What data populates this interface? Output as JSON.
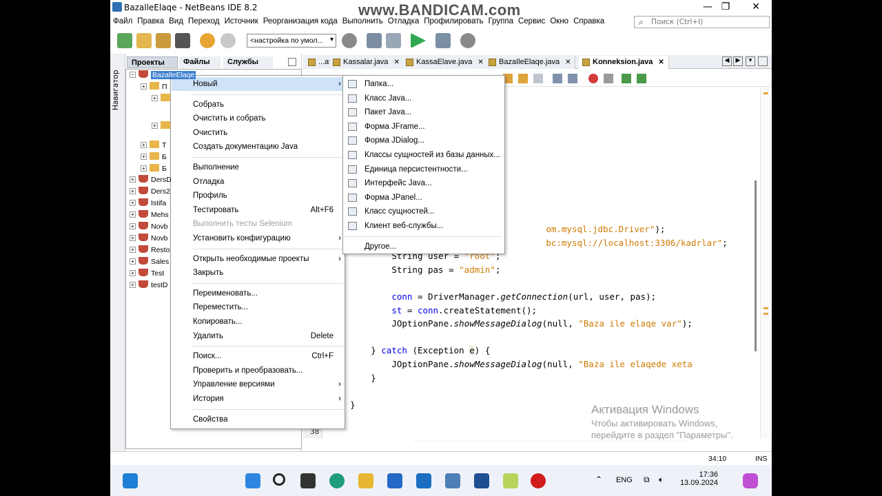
{
  "window": {
    "title": "BazalleElaqe - NetBeans IDE 8.2",
    "watermark": "www.BANDICAM.com"
  },
  "menubar": [
    "Файл",
    "Правка",
    "Вид",
    "Переход",
    "Источник",
    "Реорганизация кода",
    "Выполнить",
    "Отладка",
    "Профилировать",
    "Группа",
    "Сервис",
    "Окно",
    "Справка"
  ],
  "search": {
    "placeholder": "Поиск (Ctrl+I)"
  },
  "toolbar": {
    "config_value": "<настройка по умол..."
  },
  "left_panel": {
    "tabs": [
      "Проекты",
      "Файлы",
      "Службы"
    ],
    "navigator_label": "Навигатор",
    "tree": {
      "root": "BazalleElaqe",
      "sub": [
        {
          "label": "П",
          "kind": "folder"
        },
        {
          "label": "",
          "kind": "folder"
        },
        {
          "label": "",
          "kind": "folder"
        },
        {
          "label": "Т",
          "kind": "folder"
        },
        {
          "label": "Б",
          "kind": "folder"
        },
        {
          "label": "Б",
          "kind": "folder"
        }
      ],
      "projects": [
        "DersD",
        "Ders2",
        "Istifa",
        "Mehs",
        "Novb",
        "Novb",
        "Resto",
        "Sales",
        "Test",
        "testD"
      ]
    }
  },
  "editor": {
    "tabs": [
      {
        "label": "...ava",
        "active": false
      },
      {
        "label": "Kassalar.java",
        "active": false
      },
      {
        "label": "KassaElave.java",
        "active": false
      },
      {
        "label": "BazaIleElaqe.java",
        "active": false
      },
      {
        "label": "Konneksion.java",
        "active": true
      }
    ],
    "code_lines": [
      {
        "indent": "            ",
        "parts": [
          {
            "t": "om.mysql.jdbc.Driver\"",
            "c": "str"
          },
          {
            "t": ");",
            "c": ""
          }
        ],
        "offset": 224
      },
      {
        "indent": "            ",
        "parts": [
          {
            "t": "bc:mysql://localhost:3306/kadrlar\"",
            "c": "str"
          },
          {
            "t": ";",
            "c": ""
          }
        ],
        "offset": 224
      },
      {
        "indent": "            ",
        "parts": [
          {
            "t": "String user = ",
            "c": ""
          },
          {
            "t": "\"root\"",
            "c": "str"
          },
          {
            "t": ";",
            "c": ""
          }
        ],
        "offset": 0
      },
      {
        "indent": "            ",
        "parts": [
          {
            "t": "String pas = ",
            "c": ""
          },
          {
            "t": "\"admin\"",
            "c": "str"
          },
          {
            "t": ";",
            "c": ""
          }
        ],
        "offset": 0
      },
      {
        "indent": "",
        "parts": [],
        "offset": 0
      },
      {
        "indent": "            ",
        "parts": [
          {
            "t": "conn",
            "c": "kw"
          },
          {
            "t": " = DriverManager.",
            "c": ""
          },
          {
            "t": "getConnection",
            "c": "it"
          },
          {
            "t": "(url, user, pas);",
            "c": ""
          }
        ],
        "offset": 0
      },
      {
        "indent": "            ",
        "parts": [
          {
            "t": "st",
            "c": "kw"
          },
          {
            "t": " = ",
            "c": ""
          },
          {
            "t": "conn",
            "c": "kw"
          },
          {
            "t": ".createStatement();",
            "c": ""
          }
        ],
        "offset": 0
      },
      {
        "indent": "            ",
        "parts": [
          {
            "t": "JOptionPane.",
            "c": ""
          },
          {
            "t": "showMessageDialog",
            "c": "it"
          },
          {
            "t": "(null, ",
            "c": ""
          },
          {
            "t": "\"Baza ile elaqe var\"",
            "c": "str"
          },
          {
            "t": ");",
            "c": ""
          }
        ],
        "offset": 0
      },
      {
        "indent": "",
        "parts": [],
        "offset": 0
      },
      {
        "indent": "        ",
        "parts": [
          {
            "t": "} ",
            "c": ""
          },
          {
            "t": "catch",
            "c": "kw"
          },
          {
            "t": " (Exception ",
            "c": ""
          },
          {
            "t": "e",
            "c": "hl"
          },
          {
            "t": ") {",
            "c": ""
          }
        ],
        "offset": 0
      },
      {
        "indent": "            ",
        "parts": [
          {
            "t": "JOptionPane.",
            "c": ""
          },
          {
            "t": "showMessageDialog",
            "c": "it"
          },
          {
            "t": "(null, ",
            "c": ""
          },
          {
            "t": "\"Baza ile elaqede xeta",
            "c": "str"
          }
        ],
        "offset": 0
      },
      {
        "indent": "        ",
        "parts": [
          {
            "t": "}",
            "c": ""
          }
        ],
        "offset": 0
      },
      {
        "indent": "",
        "parts": [],
        "offset": 0
      },
      {
        "indent": "    ",
        "parts": [
          {
            "t": "}",
            "c": ""
          }
        ],
        "offset": 0
      }
    ],
    "line_number": "38"
  },
  "status": {
    "position": "34:10",
    "mode": "INS"
  },
  "activation": {
    "title": "Активация Windows",
    "line1": "Чтобы активировать Windows,",
    "line2": "перейдите в раздел \"Параметры\"."
  },
  "context_menu": [
    {
      "label": "Новый",
      "submenu": true,
      "selected": true
    },
    {
      "sep": true
    },
    {
      "label": "Собрать"
    },
    {
      "label": "Очистить и собрать"
    },
    {
      "label": "Очистить"
    },
    {
      "label": "Создать документацию Java"
    },
    {
      "sep": true
    },
    {
      "label": "Выполнение"
    },
    {
      "label": "Отладка"
    },
    {
      "label": "Профиль"
    },
    {
      "label": "Тестировать",
      "shortcut": "Alt+F6"
    },
    {
      "label": "Выполнить тесты Selenium",
      "disabled": true
    },
    {
      "label": "Установить конфигурацию",
      "submenu": true
    },
    {
      "sep": true
    },
    {
      "label": "Открыть необходимые проекты",
      "submenu": true
    },
    {
      "label": "Закрыть"
    },
    {
      "sep": true
    },
    {
      "label": "Переименовать..."
    },
    {
      "label": "Переместить..."
    },
    {
      "label": "Копировать..."
    },
    {
      "label": "Удалить",
      "shortcut": "Delete"
    },
    {
      "sep": true
    },
    {
      "label": "Поиск...",
      "shortcut": "Ctrl+F"
    },
    {
      "label": "Проверить и преобразовать..."
    },
    {
      "label": "Управление версиями",
      "submenu": true
    },
    {
      "label": "История",
      "submenu": true
    },
    {
      "sep": true
    },
    {
      "label": "Свойства"
    }
  ],
  "submenu": [
    {
      "label": "Папка...",
      "icon": "folder-icon"
    },
    {
      "label": "Класс Java...",
      "icon": "java-class-icon"
    },
    {
      "label": "Пакет Java...",
      "icon": "package-icon"
    },
    {
      "label": "Форма JFrame...",
      "icon": "jframe-icon"
    },
    {
      "label": "Форма JDialog...",
      "icon": "jdialog-icon"
    },
    {
      "label": "Классы сущностей из базы данных...",
      "icon": "entity-db-icon"
    },
    {
      "label": "Единица персистентности...",
      "icon": "persistence-icon"
    },
    {
      "label": "Интерфейс Java...",
      "icon": "interface-icon"
    },
    {
      "label": "Форма JPanel...",
      "icon": "jpanel-icon"
    },
    {
      "label": "Класс сущностей...",
      "icon": "entity-class-icon"
    },
    {
      "label": "Клиент веб-службы...",
      "icon": "web-service-icon"
    },
    {
      "sep": true
    },
    {
      "label": "Другое...",
      "icon": ""
    }
  ],
  "taskbar": {
    "lang": "ENG",
    "time": "17:36",
    "date": "13.09.2024"
  }
}
